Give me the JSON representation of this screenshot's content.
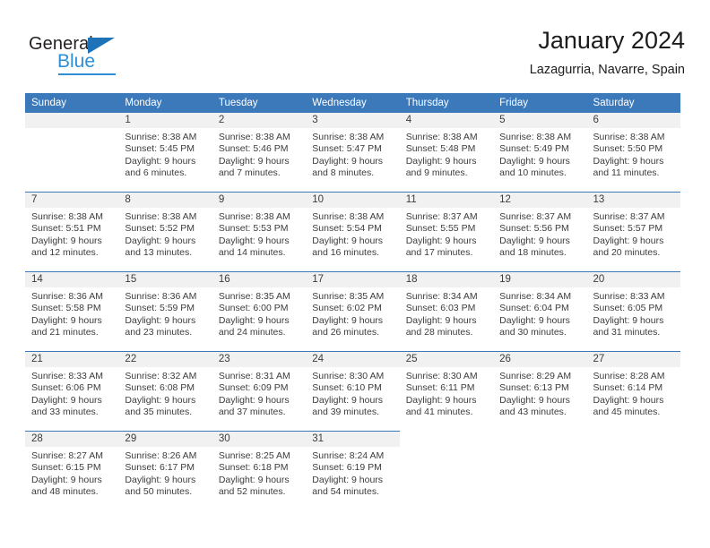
{
  "brand": {
    "name_part1": "General",
    "name_part2": "Blue",
    "logo_icon": "triangle-icon",
    "accent_color": "#2e8ed6"
  },
  "header": {
    "title": "January 2024",
    "subtitle": "Lazagurria, Navarre, Spain"
  },
  "theme": {
    "header_blue": "#3b79bb",
    "daynum_band": "#f1f1f1",
    "text": "#3c3c3c"
  },
  "calendar": {
    "weekday_headers": [
      "Sunday",
      "Monday",
      "Tuesday",
      "Wednesday",
      "Thursday",
      "Friday",
      "Saturday"
    ],
    "weeks": [
      [
        {
          "blank": true
        },
        {
          "day": "1",
          "sunrise": "Sunrise: 8:38 AM",
          "sunset": "Sunset: 5:45 PM",
          "daylight1": "Daylight: 9 hours",
          "daylight2": "and 6 minutes."
        },
        {
          "day": "2",
          "sunrise": "Sunrise: 8:38 AM",
          "sunset": "Sunset: 5:46 PM",
          "daylight1": "Daylight: 9 hours",
          "daylight2": "and 7 minutes."
        },
        {
          "day": "3",
          "sunrise": "Sunrise: 8:38 AM",
          "sunset": "Sunset: 5:47 PM",
          "daylight1": "Daylight: 9 hours",
          "daylight2": "and 8 minutes."
        },
        {
          "day": "4",
          "sunrise": "Sunrise: 8:38 AM",
          "sunset": "Sunset: 5:48 PM",
          "daylight1": "Daylight: 9 hours",
          "daylight2": "and 9 minutes."
        },
        {
          "day": "5",
          "sunrise": "Sunrise: 8:38 AM",
          "sunset": "Sunset: 5:49 PM",
          "daylight1": "Daylight: 9 hours",
          "daylight2": "and 10 minutes."
        },
        {
          "day": "6",
          "sunrise": "Sunrise: 8:38 AM",
          "sunset": "Sunset: 5:50 PM",
          "daylight1": "Daylight: 9 hours",
          "daylight2": "and 11 minutes."
        }
      ],
      [
        {
          "day": "7",
          "sunrise": "Sunrise: 8:38 AM",
          "sunset": "Sunset: 5:51 PM",
          "daylight1": "Daylight: 9 hours",
          "daylight2": "and 12 minutes."
        },
        {
          "day": "8",
          "sunrise": "Sunrise: 8:38 AM",
          "sunset": "Sunset: 5:52 PM",
          "daylight1": "Daylight: 9 hours",
          "daylight2": "and 13 minutes."
        },
        {
          "day": "9",
          "sunrise": "Sunrise: 8:38 AM",
          "sunset": "Sunset: 5:53 PM",
          "daylight1": "Daylight: 9 hours",
          "daylight2": "and 14 minutes."
        },
        {
          "day": "10",
          "sunrise": "Sunrise: 8:38 AM",
          "sunset": "Sunset: 5:54 PM",
          "daylight1": "Daylight: 9 hours",
          "daylight2": "and 16 minutes."
        },
        {
          "day": "11",
          "sunrise": "Sunrise: 8:37 AM",
          "sunset": "Sunset: 5:55 PM",
          "daylight1": "Daylight: 9 hours",
          "daylight2": "and 17 minutes."
        },
        {
          "day": "12",
          "sunrise": "Sunrise: 8:37 AM",
          "sunset": "Sunset: 5:56 PM",
          "daylight1": "Daylight: 9 hours",
          "daylight2": "and 18 minutes."
        },
        {
          "day": "13",
          "sunrise": "Sunrise: 8:37 AM",
          "sunset": "Sunset: 5:57 PM",
          "daylight1": "Daylight: 9 hours",
          "daylight2": "and 20 minutes."
        }
      ],
      [
        {
          "day": "14",
          "sunrise": "Sunrise: 8:36 AM",
          "sunset": "Sunset: 5:58 PM",
          "daylight1": "Daylight: 9 hours",
          "daylight2": "and 21 minutes."
        },
        {
          "day": "15",
          "sunrise": "Sunrise: 8:36 AM",
          "sunset": "Sunset: 5:59 PM",
          "daylight1": "Daylight: 9 hours",
          "daylight2": "and 23 minutes."
        },
        {
          "day": "16",
          "sunrise": "Sunrise: 8:35 AM",
          "sunset": "Sunset: 6:00 PM",
          "daylight1": "Daylight: 9 hours",
          "daylight2": "and 24 minutes."
        },
        {
          "day": "17",
          "sunrise": "Sunrise: 8:35 AM",
          "sunset": "Sunset: 6:02 PM",
          "daylight1": "Daylight: 9 hours",
          "daylight2": "and 26 minutes."
        },
        {
          "day": "18",
          "sunrise": "Sunrise: 8:34 AM",
          "sunset": "Sunset: 6:03 PM",
          "daylight1": "Daylight: 9 hours",
          "daylight2": "and 28 minutes."
        },
        {
          "day": "19",
          "sunrise": "Sunrise: 8:34 AM",
          "sunset": "Sunset: 6:04 PM",
          "daylight1": "Daylight: 9 hours",
          "daylight2": "and 30 minutes."
        },
        {
          "day": "20",
          "sunrise": "Sunrise: 8:33 AM",
          "sunset": "Sunset: 6:05 PM",
          "daylight1": "Daylight: 9 hours",
          "daylight2": "and 31 minutes."
        }
      ],
      [
        {
          "day": "21",
          "sunrise": "Sunrise: 8:33 AM",
          "sunset": "Sunset: 6:06 PM",
          "daylight1": "Daylight: 9 hours",
          "daylight2": "and 33 minutes."
        },
        {
          "day": "22",
          "sunrise": "Sunrise: 8:32 AM",
          "sunset": "Sunset: 6:08 PM",
          "daylight1": "Daylight: 9 hours",
          "daylight2": "and 35 minutes."
        },
        {
          "day": "23",
          "sunrise": "Sunrise: 8:31 AM",
          "sunset": "Sunset: 6:09 PM",
          "daylight1": "Daylight: 9 hours",
          "daylight2": "and 37 minutes."
        },
        {
          "day": "24",
          "sunrise": "Sunrise: 8:30 AM",
          "sunset": "Sunset: 6:10 PM",
          "daylight1": "Daylight: 9 hours",
          "daylight2": "and 39 minutes."
        },
        {
          "day": "25",
          "sunrise": "Sunrise: 8:30 AM",
          "sunset": "Sunset: 6:11 PM",
          "daylight1": "Daylight: 9 hours",
          "daylight2": "and 41 minutes."
        },
        {
          "day": "26",
          "sunrise": "Sunrise: 8:29 AM",
          "sunset": "Sunset: 6:13 PM",
          "daylight1": "Daylight: 9 hours",
          "daylight2": "and 43 minutes."
        },
        {
          "day": "27",
          "sunrise": "Sunrise: 8:28 AM",
          "sunset": "Sunset: 6:14 PM",
          "daylight1": "Daylight: 9 hours",
          "daylight2": "and 45 minutes."
        }
      ],
      [
        {
          "day": "28",
          "sunrise": "Sunrise: 8:27 AM",
          "sunset": "Sunset: 6:15 PM",
          "daylight1": "Daylight: 9 hours",
          "daylight2": "and 48 minutes."
        },
        {
          "day": "29",
          "sunrise": "Sunrise: 8:26 AM",
          "sunset": "Sunset: 6:17 PM",
          "daylight1": "Daylight: 9 hours",
          "daylight2": "and 50 minutes."
        },
        {
          "day": "30",
          "sunrise": "Sunrise: 8:25 AM",
          "sunset": "Sunset: 6:18 PM",
          "daylight1": "Daylight: 9 hours",
          "daylight2": "and 52 minutes."
        },
        {
          "day": "31",
          "sunrise": "Sunrise: 8:24 AM",
          "sunset": "Sunset: 6:19 PM",
          "daylight1": "Daylight: 9 hours",
          "daylight2": "and 54 minutes."
        },
        {
          "empty": true
        },
        {
          "empty": true
        },
        {
          "empty": true
        }
      ]
    ]
  }
}
